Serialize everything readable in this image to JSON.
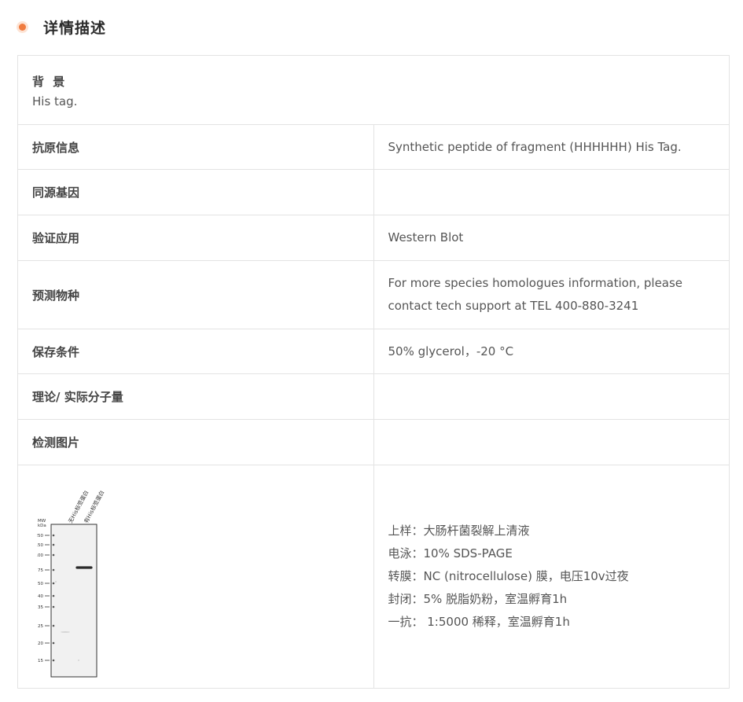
{
  "section": {
    "title": "详情描述"
  },
  "background": {
    "label": "背 景",
    "value": "His tag."
  },
  "rows": [
    {
      "label": "抗原信息",
      "value": "Synthetic peptide of fragment (HHHHHH) His Tag."
    },
    {
      "label": "同源基因",
      "value": ""
    },
    {
      "label": "验证应用",
      "value": "Western Blot"
    },
    {
      "label": "预测物种",
      "value": "For more species homologues information, please contact tech support at TEL 400-880-3241"
    },
    {
      "label": "保存条件",
      "value": "50% glycerol，-20 °C"
    },
    {
      "label": "理论/ 实际分子量",
      "value": ""
    },
    {
      "label": "检测图片",
      "value": ""
    }
  ],
  "blot": {
    "lanes": [
      "无His标签蛋白",
      "有His标签蛋白"
    ],
    "mw_header": [
      "MW",
      "kDa"
    ],
    "markers": [
      "250",
      "150",
      "100",
      "75",
      "50",
      "40",
      "35",
      "25",
      "20",
      "15"
    ]
  },
  "method": [
    "上样：大肠杆菌裂解上清液",
    "电泳：10% SDS-PAGE",
    "转膜：NC (nitrocellulose) 膜，电压10v过夜",
    "封闭：5% 脱脂奶粉，室温孵育1h",
    "一抗： 1:5000 稀释，室温孵育1h"
  ]
}
